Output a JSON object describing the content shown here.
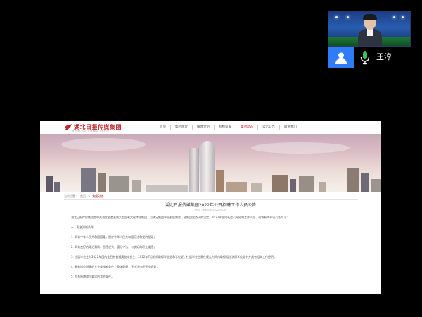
{
  "meeting": {
    "participant_name": "王淳",
    "icons": {
      "avatar": "user-icon",
      "mic": "microphone-icon"
    },
    "colors": {
      "avatar_bg": "#2f7cf6",
      "mic_green": "#3cc25a"
    }
  },
  "website": {
    "logo_text": "湖北日报传媒集团",
    "logo_sub": "HUBEI DAILY MEDIA GROUP",
    "nav": [
      "首页",
      "集团简介",
      "媒体介绍",
      "机构设置",
      "集团动态",
      "公示公告",
      "联系我们"
    ],
    "active_nav_index": 4,
    "breadcrumb": [
      "当前位置：",
      "首页",
      "集团动态"
    ],
    "article": {
      "title": "湖北日报传媒集团2022年公开招聘工作人员公告",
      "meta": "来源：集团动态    2022-03-xx",
      "paragraphs": [
        "湖北日报传媒集团是中共湖北省委直属大型国有文化传媒集团，为满足集团事业发展需要，经集团党委研究决定，2022年面向社会公开招聘工作人员，现将有关事项公告如下：",
        "一、报名资格条件",
        "1. 具有中华人民共和国国籍，拥护中华人民共和国宪法和党的领导；",
        "2. 具有良好的政治素质、品德优秀，遵纪守法，有良好的职业道德；",
        "3. 应届毕业生为2022年国内全日制普通高校毕业生，2022年7月前须取得毕业证和学位证；往届毕业生需在规定时间内取得相应学历学位证书并具有相关工作经历；",
        "4. 具有岗位所需的专业或技能条件，身体健康，无违法违纪不良记录；",
        "5. 符合招聘岗位要求的其他条件。"
      ]
    },
    "colors": {
      "brand_red": "#c0272d"
    }
  }
}
